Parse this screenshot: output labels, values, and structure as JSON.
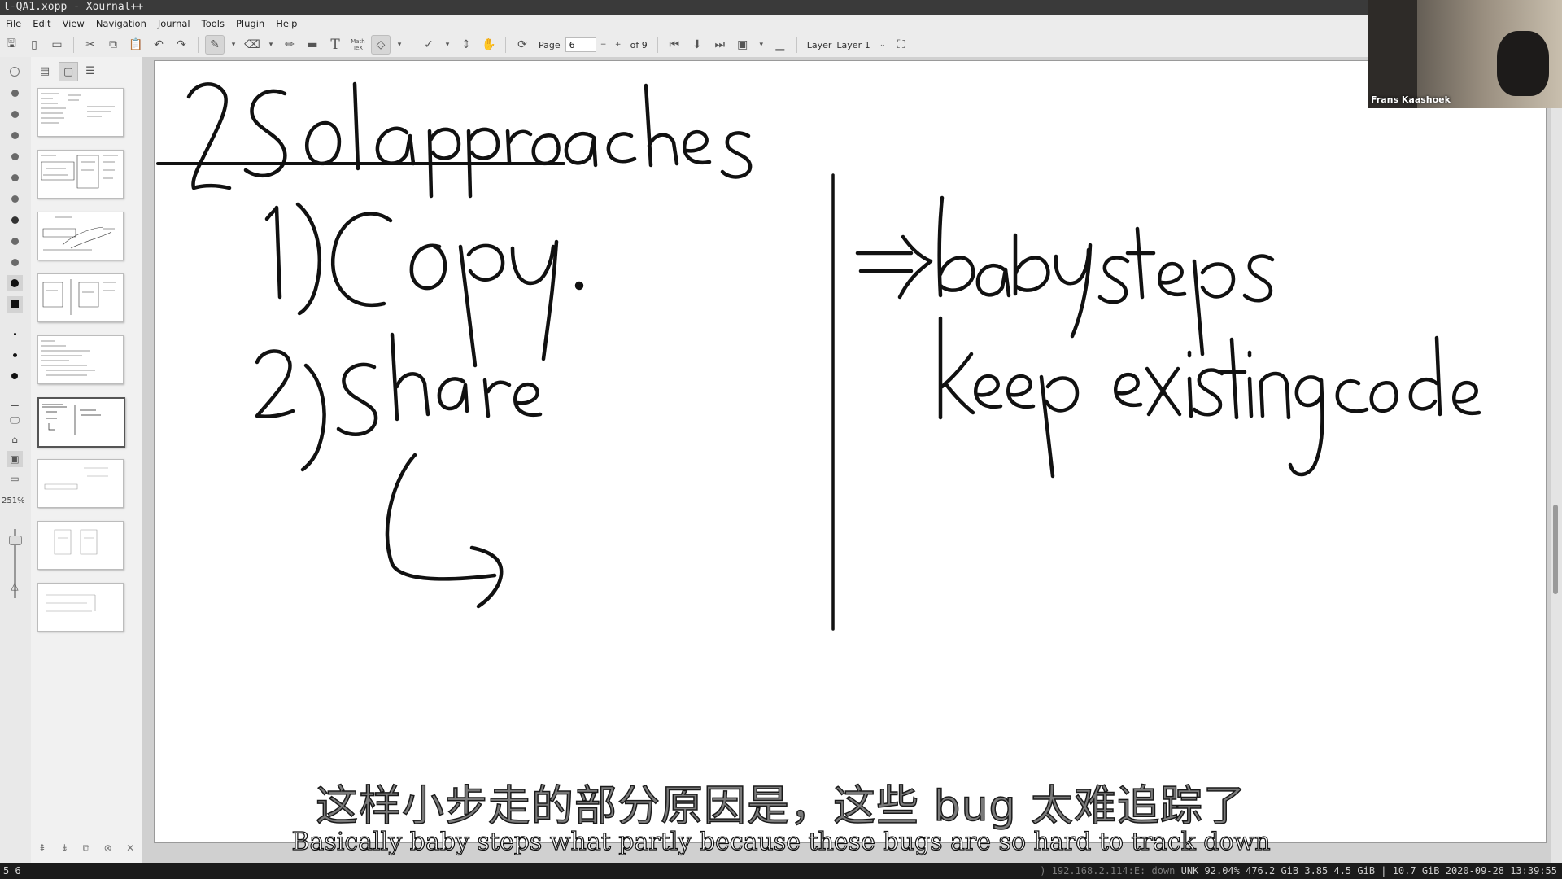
{
  "window": {
    "title": "l-QA1.xopp - Xournal++"
  },
  "menu": [
    "File",
    "Edit",
    "View",
    "Navigation",
    "Journal",
    "Tools",
    "Plugin",
    "Help"
  ],
  "toolbar": {
    "page_label": "Page",
    "page_value": "6",
    "page_total": "of 9",
    "layer_label": "Layer",
    "layer_value": "Layer 1",
    "math_tex": "Math TeX"
  },
  "left_tools": {
    "zoom_value": "251%"
  },
  "sidebar": {
    "pages": 9,
    "current_page": 6
  },
  "webcam": {
    "participant_name": "Frans Kaashoek"
  },
  "subtitles": {
    "chinese": "这样小步走的部分原因是，这些 bug 太难追踪了",
    "english": "Basically baby steps what partly because these bugs are so hard to track down"
  },
  "statusbar": {
    "left": "5 6",
    "right_dim": ") 192.168.2.114:E: down",
    "right": "UNK 92.04% 476.2 GiB 3.85 4.5 GiB | 10.7 GiB 2020-09-28 13:39:55"
  },
  "colors": {
    "ink": "#111111",
    "page": "#ffffff",
    "chrome": "#ececec"
  },
  "page_content": {
    "heading": "2 Sol approaches",
    "item1": "1) copy.",
    "item2": "2) share",
    "right_line1": "⇒ baby steps",
    "right_line2": "keep existing code"
  }
}
